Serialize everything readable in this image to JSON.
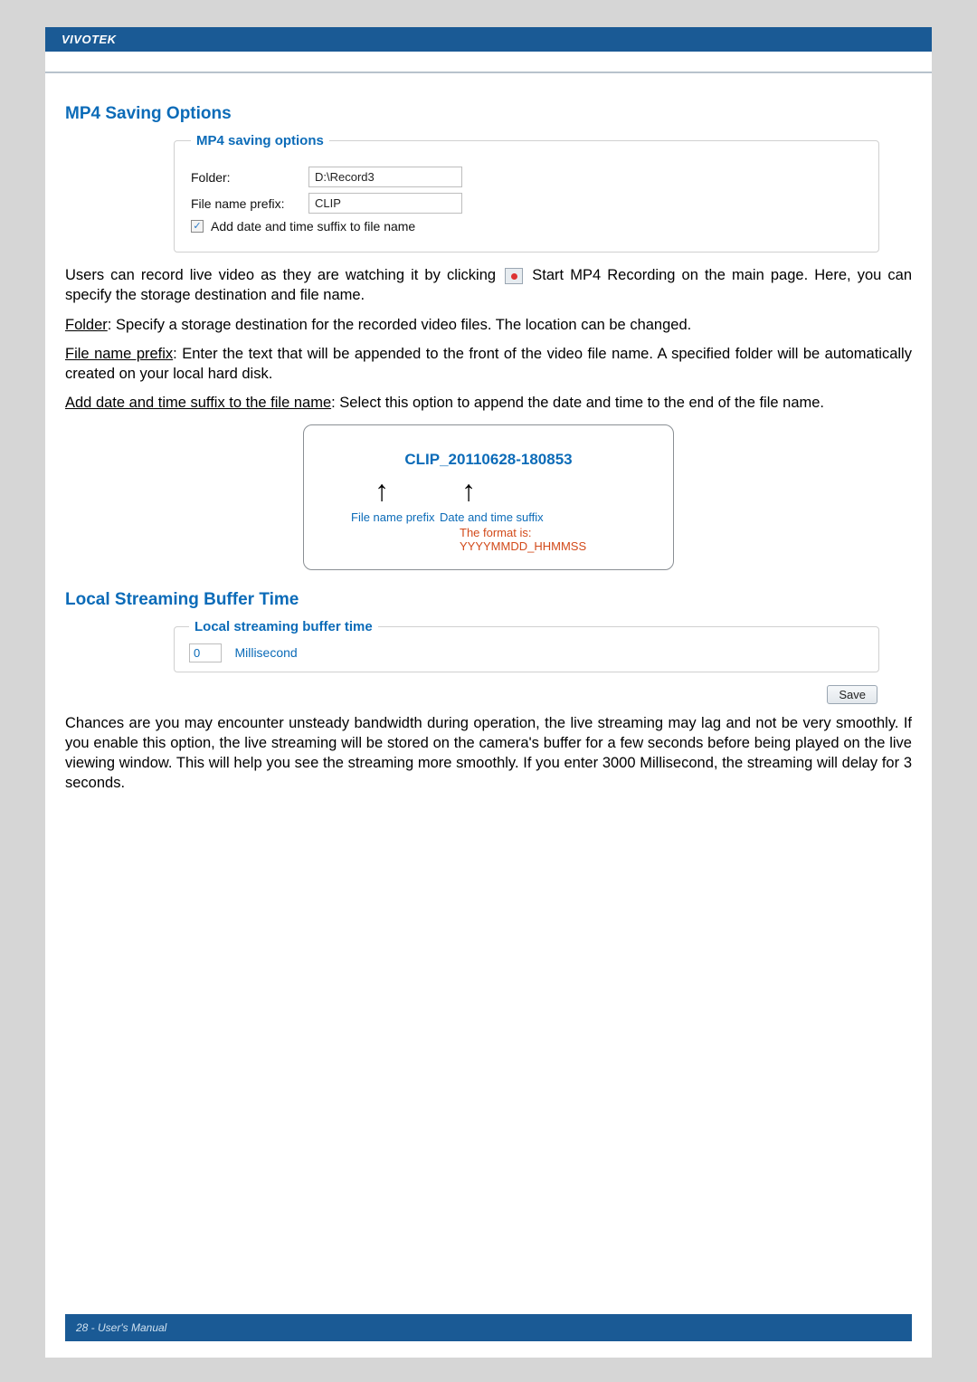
{
  "header": {
    "brand": "VIVOTEK"
  },
  "section1": {
    "title": "MP4 Saving Options",
    "fieldset_legend": "MP4 saving options",
    "folder_label": "Folder:",
    "folder_value": "D:\\Record3",
    "prefix_label": "File name prefix:",
    "prefix_value": "CLIP",
    "add_suffix_checked": "✓",
    "add_suffix_label": "Add date and time suffix to file name",
    "para1_a": "Users can record live video as they are watching it by clicking ",
    "para1_b": " Start MP4 Recording on the main page. Here, you can specify the storage destination and file name.",
    "para2_u": "Folder",
    "para2_rest": ": Specify a storage destination for the recorded video files. The location can be changed.",
    "para3_u": "File name prefix",
    "para3_rest": ": Enter the text that will be appended to the front of the video file name. A specified folder will be automatically created on your local hard disk.",
    "para4_u": "Add date and time suffix to the file name",
    "para4_rest": ": Select this option to append the date and time to the end of the file name."
  },
  "example": {
    "clip_name": "CLIP_20110628-180853",
    "prefix_label": "File name prefix",
    "suffix_label": "Date and time suffix",
    "format_label": "The format is: YYYYMMDD_HHMMSS"
  },
  "section2": {
    "title": "Local Streaming Buffer Time",
    "fieldset_legend": "Local streaming buffer time",
    "value": "0",
    "unit": "Millisecond",
    "save_label": "Save",
    "para": "Chances are you may encounter unsteady bandwidth during operation, the live streaming may lag and not be very smoothly. If you enable this option, the live streaming will be stored on the camera's buffer for a few seconds before being played on the live viewing window. This will help you see the streaming more smoothly. If you enter 3000 Millisecond, the streaming will delay for 3 seconds."
  },
  "footer": {
    "text": "28 - User's Manual"
  }
}
